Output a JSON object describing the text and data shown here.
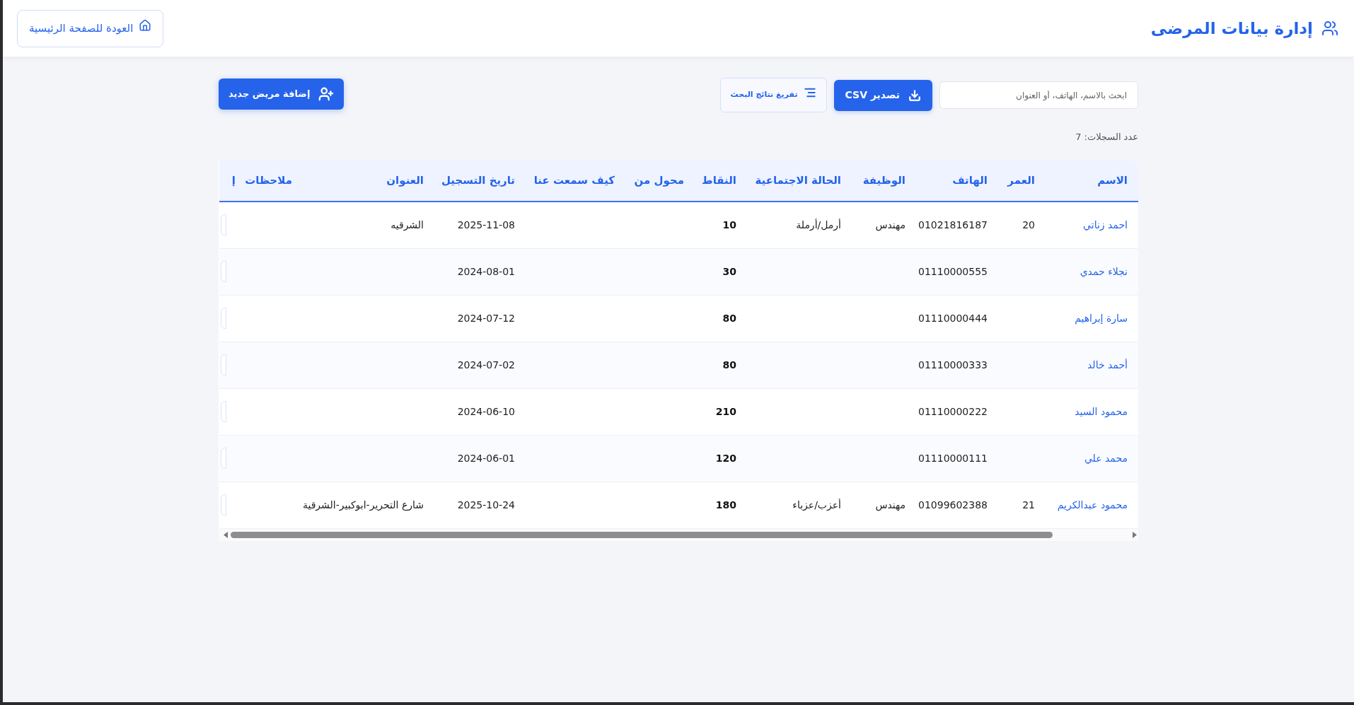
{
  "header": {
    "title": "إدارة بيانات المرضى",
    "back_button": "العودة للصفحة الرئيسية"
  },
  "toolbar": {
    "search": {
      "placeholder": "ابحث بالاسم، الهاتف، أو العنوان"
    },
    "export_button": "تصدير CSV",
    "clear_button": "تفريغ نتائج البحث",
    "add_button": "إضافة مريض جديد"
  },
  "record_count": "عدد السجلات: 7",
  "table": {
    "columns": [
      "الاسم",
      "العمر",
      "الهاتف",
      "الوظيفة",
      "الحالة الاجتماعية",
      "النقاط",
      "محول من",
      "كيف سمعت عنا",
      "تاريخ التسجيل",
      "العنوان",
      "ملاحظات",
      "إ"
    ],
    "rows": [
      {
        "name": "احمد زناتي",
        "age": "20",
        "phone": "01021816187",
        "job": "مهندس",
        "marital_status": "أرمل/أرملة",
        "points": "10",
        "registered": "2025-11-08",
        "address": "الشرقيه"
      },
      {
        "name": "نجلاء حمدي",
        "phone": "01110000555",
        "points": "30",
        "registered": "2024-08-01"
      },
      {
        "name": "سارة إبراهيم",
        "phone": "01110000444",
        "points": "80",
        "registered": "2024-07-12"
      },
      {
        "name": "أحمد خالد",
        "phone": "01110000333",
        "points": "80",
        "registered": "2024-07-02"
      },
      {
        "name": "محمود السيد",
        "phone": "01110000222",
        "points": "210",
        "registered": "2024-06-10"
      },
      {
        "name": "محمد علي",
        "phone": "01110000111",
        "points": "120",
        "registered": "2024-06-01"
      },
      {
        "name": "محمود عبدالكريم",
        "age": "21",
        "phone": "01099602388",
        "job": "مهندس",
        "marital_status": "أعزب/عزباء",
        "points": "180",
        "registered": "2025-10-24",
        "address": "شارع التحرير-ابوكبير-الشرقية"
      }
    ]
  }
}
